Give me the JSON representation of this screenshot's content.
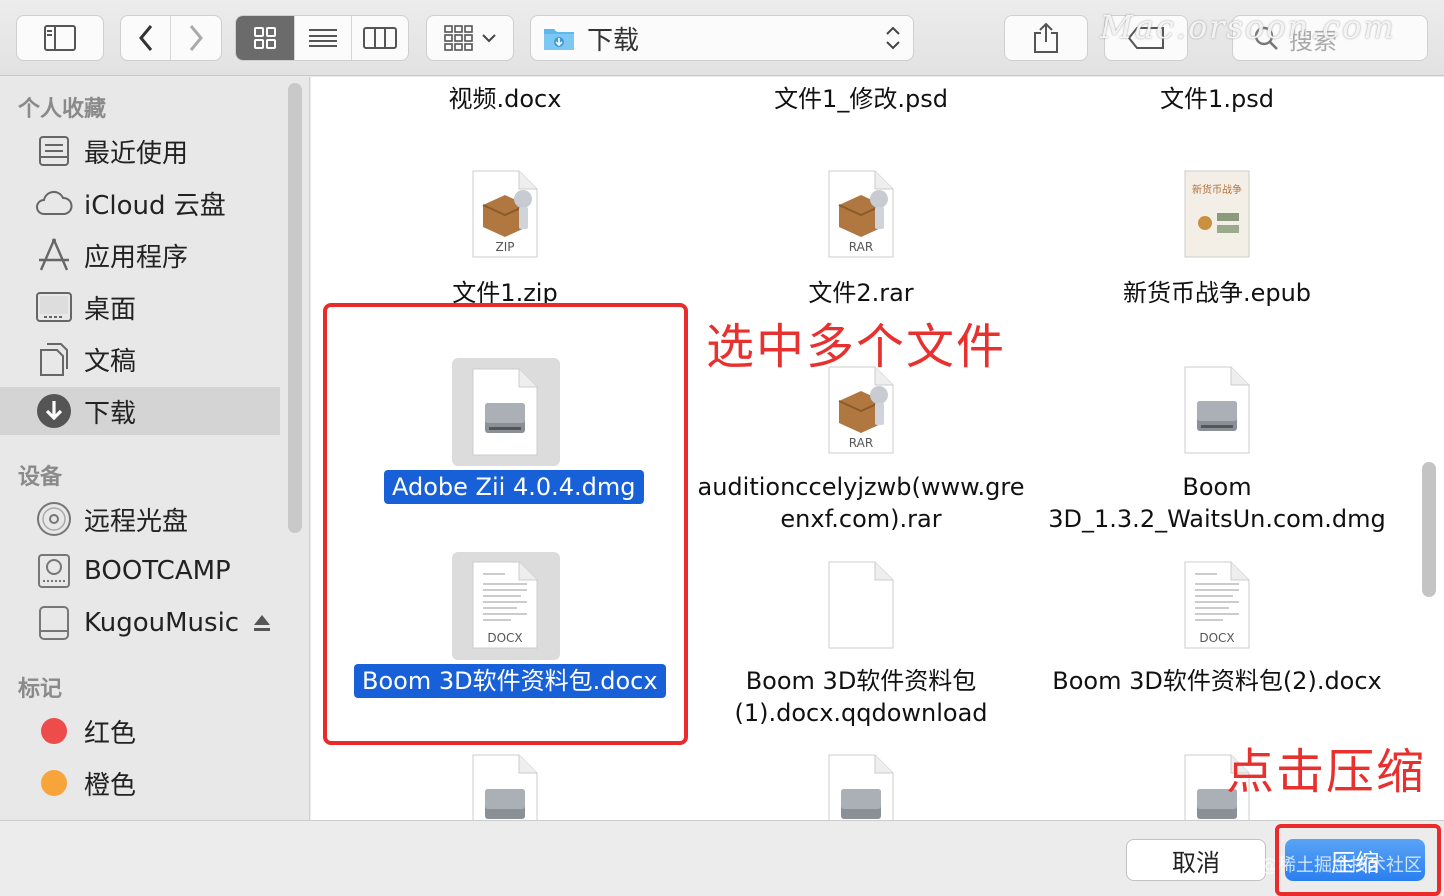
{
  "toolbar": {
    "path_label": "下载",
    "search_placeholder": "搜索",
    "watermark": "Mac.orsoon.com"
  },
  "sidebar": {
    "favorites_header": "个人收藏",
    "favorites": [
      {
        "label": "最近使用",
        "icon": "recents-icon"
      },
      {
        "label": "iCloud 云盘",
        "icon": "icloud-icon"
      },
      {
        "label": "应用程序",
        "icon": "applications-icon"
      },
      {
        "label": "桌面",
        "icon": "desktop-icon"
      },
      {
        "label": "文稿",
        "icon": "documents-icon"
      },
      {
        "label": "下载",
        "icon": "downloads-icon",
        "selected": true
      }
    ],
    "devices_header": "设备",
    "devices": [
      {
        "label": "远程光盘",
        "icon": "remote-disc-icon"
      },
      {
        "label": "BOOTCAMP",
        "icon": "disk-icon"
      },
      {
        "label": "KugouMusic",
        "icon": "drive-icon",
        "ejectable": true
      }
    ],
    "tags_header": "标记",
    "tags": [
      {
        "label": "红色",
        "color": "#ee4b4b"
      },
      {
        "label": "橙色",
        "color": "#f7a43a"
      }
    ]
  },
  "files": [
    {
      "name": "视频.docx",
      "kind": "docx"
    },
    {
      "name": "文件1_修改.psd",
      "kind": "psd"
    },
    {
      "name": "文件1.psd",
      "kind": "psd"
    },
    {
      "name": "文件1.zip",
      "kind": "zip",
      "badge": "ZIP"
    },
    {
      "name": "文件2.rar",
      "kind": "rar",
      "badge": "RAR"
    },
    {
      "name": "新货币战争.epub",
      "kind": "epub",
      "cover_title": "新货币战争"
    },
    {
      "name": "Adobe Zii 4.0.4.dmg",
      "kind": "dmg",
      "selected": true
    },
    {
      "name_lines": [
        "auditionccelyjzwb(www.gre",
        "enxf.com).rar"
      ],
      "kind": "rar",
      "badge": "RAR"
    },
    {
      "name_lines": [
        "Boom",
        "3D_1.3.2_WaitsUn.com.dmg"
      ],
      "kind": "dmg"
    },
    {
      "name": "Boom 3D软件资料包.docx",
      "kind": "docx",
      "badge": "DOCX",
      "selected": true
    },
    {
      "name_lines": [
        "Boom 3D软件资料包",
        "(1).docx.qqdownload"
      ],
      "kind": "blank"
    },
    {
      "name": "Boom 3D软件资料包(2).docx",
      "kind": "docx",
      "badge": "DOCX"
    }
  ],
  "annotations": {
    "select_note": "选中多个文件",
    "compress_note": "点击压缩",
    "color": "#e8312f"
  },
  "buttons": {
    "cancel": "取消",
    "compress": "压缩"
  },
  "credit": "@稀土掘金技术社区",
  "colors": {
    "selection": "#1860d8",
    "primary_button": "#2a7ff0"
  }
}
